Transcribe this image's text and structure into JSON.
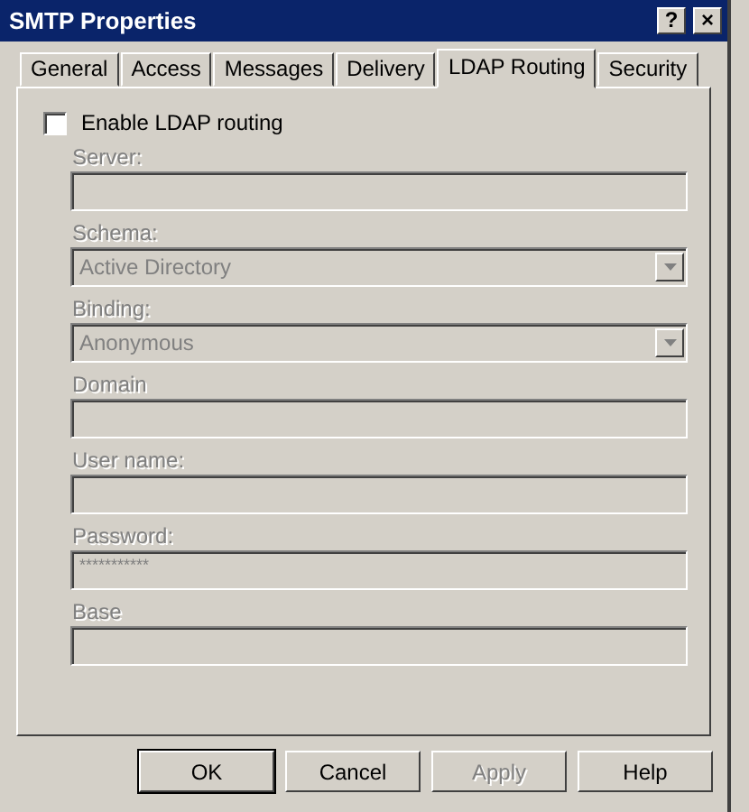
{
  "window": {
    "title": "SMTP Properties",
    "controls": [
      "?",
      "×"
    ]
  },
  "tabs": [
    {
      "label": "General",
      "selected": false
    },
    {
      "label": "Access",
      "selected": false
    },
    {
      "label": "Messages",
      "selected": false
    },
    {
      "label": "Delivery",
      "selected": false
    },
    {
      "label": "LDAP Routing",
      "selected": true
    },
    {
      "label": "Security",
      "selected": false
    }
  ],
  "enable_checkbox": {
    "label": "Enable LDAP routing",
    "checked": false
  },
  "fields": [
    {
      "kind": "text",
      "label": "Server:",
      "disabled": true
    },
    {
      "kind": "combo",
      "label": "Schema:",
      "value": "Active Directory",
      "disabled": true
    },
    {
      "kind": "combo",
      "label": "Binding:",
      "value": "Anonymous",
      "disabled": true
    },
    {
      "kind": "text",
      "label": "Domain",
      "disabled": true
    },
    {
      "kind": "text",
      "label": "User name:",
      "disabled": true
    },
    {
      "kind": "text",
      "label": "Password:",
      "value": "***********",
      "disabled": true
    },
    {
      "kind": "text",
      "label": "Base",
      "disabled": true
    }
  ],
  "buttons": [
    {
      "label": "OK",
      "disabled": false,
      "default": true
    },
    {
      "label": "Cancel",
      "disabled": false,
      "default": false
    },
    {
      "label": "Apply",
      "disabled": true,
      "default": false
    },
    {
      "label": "Help",
      "disabled": false,
      "default": false
    }
  ]
}
